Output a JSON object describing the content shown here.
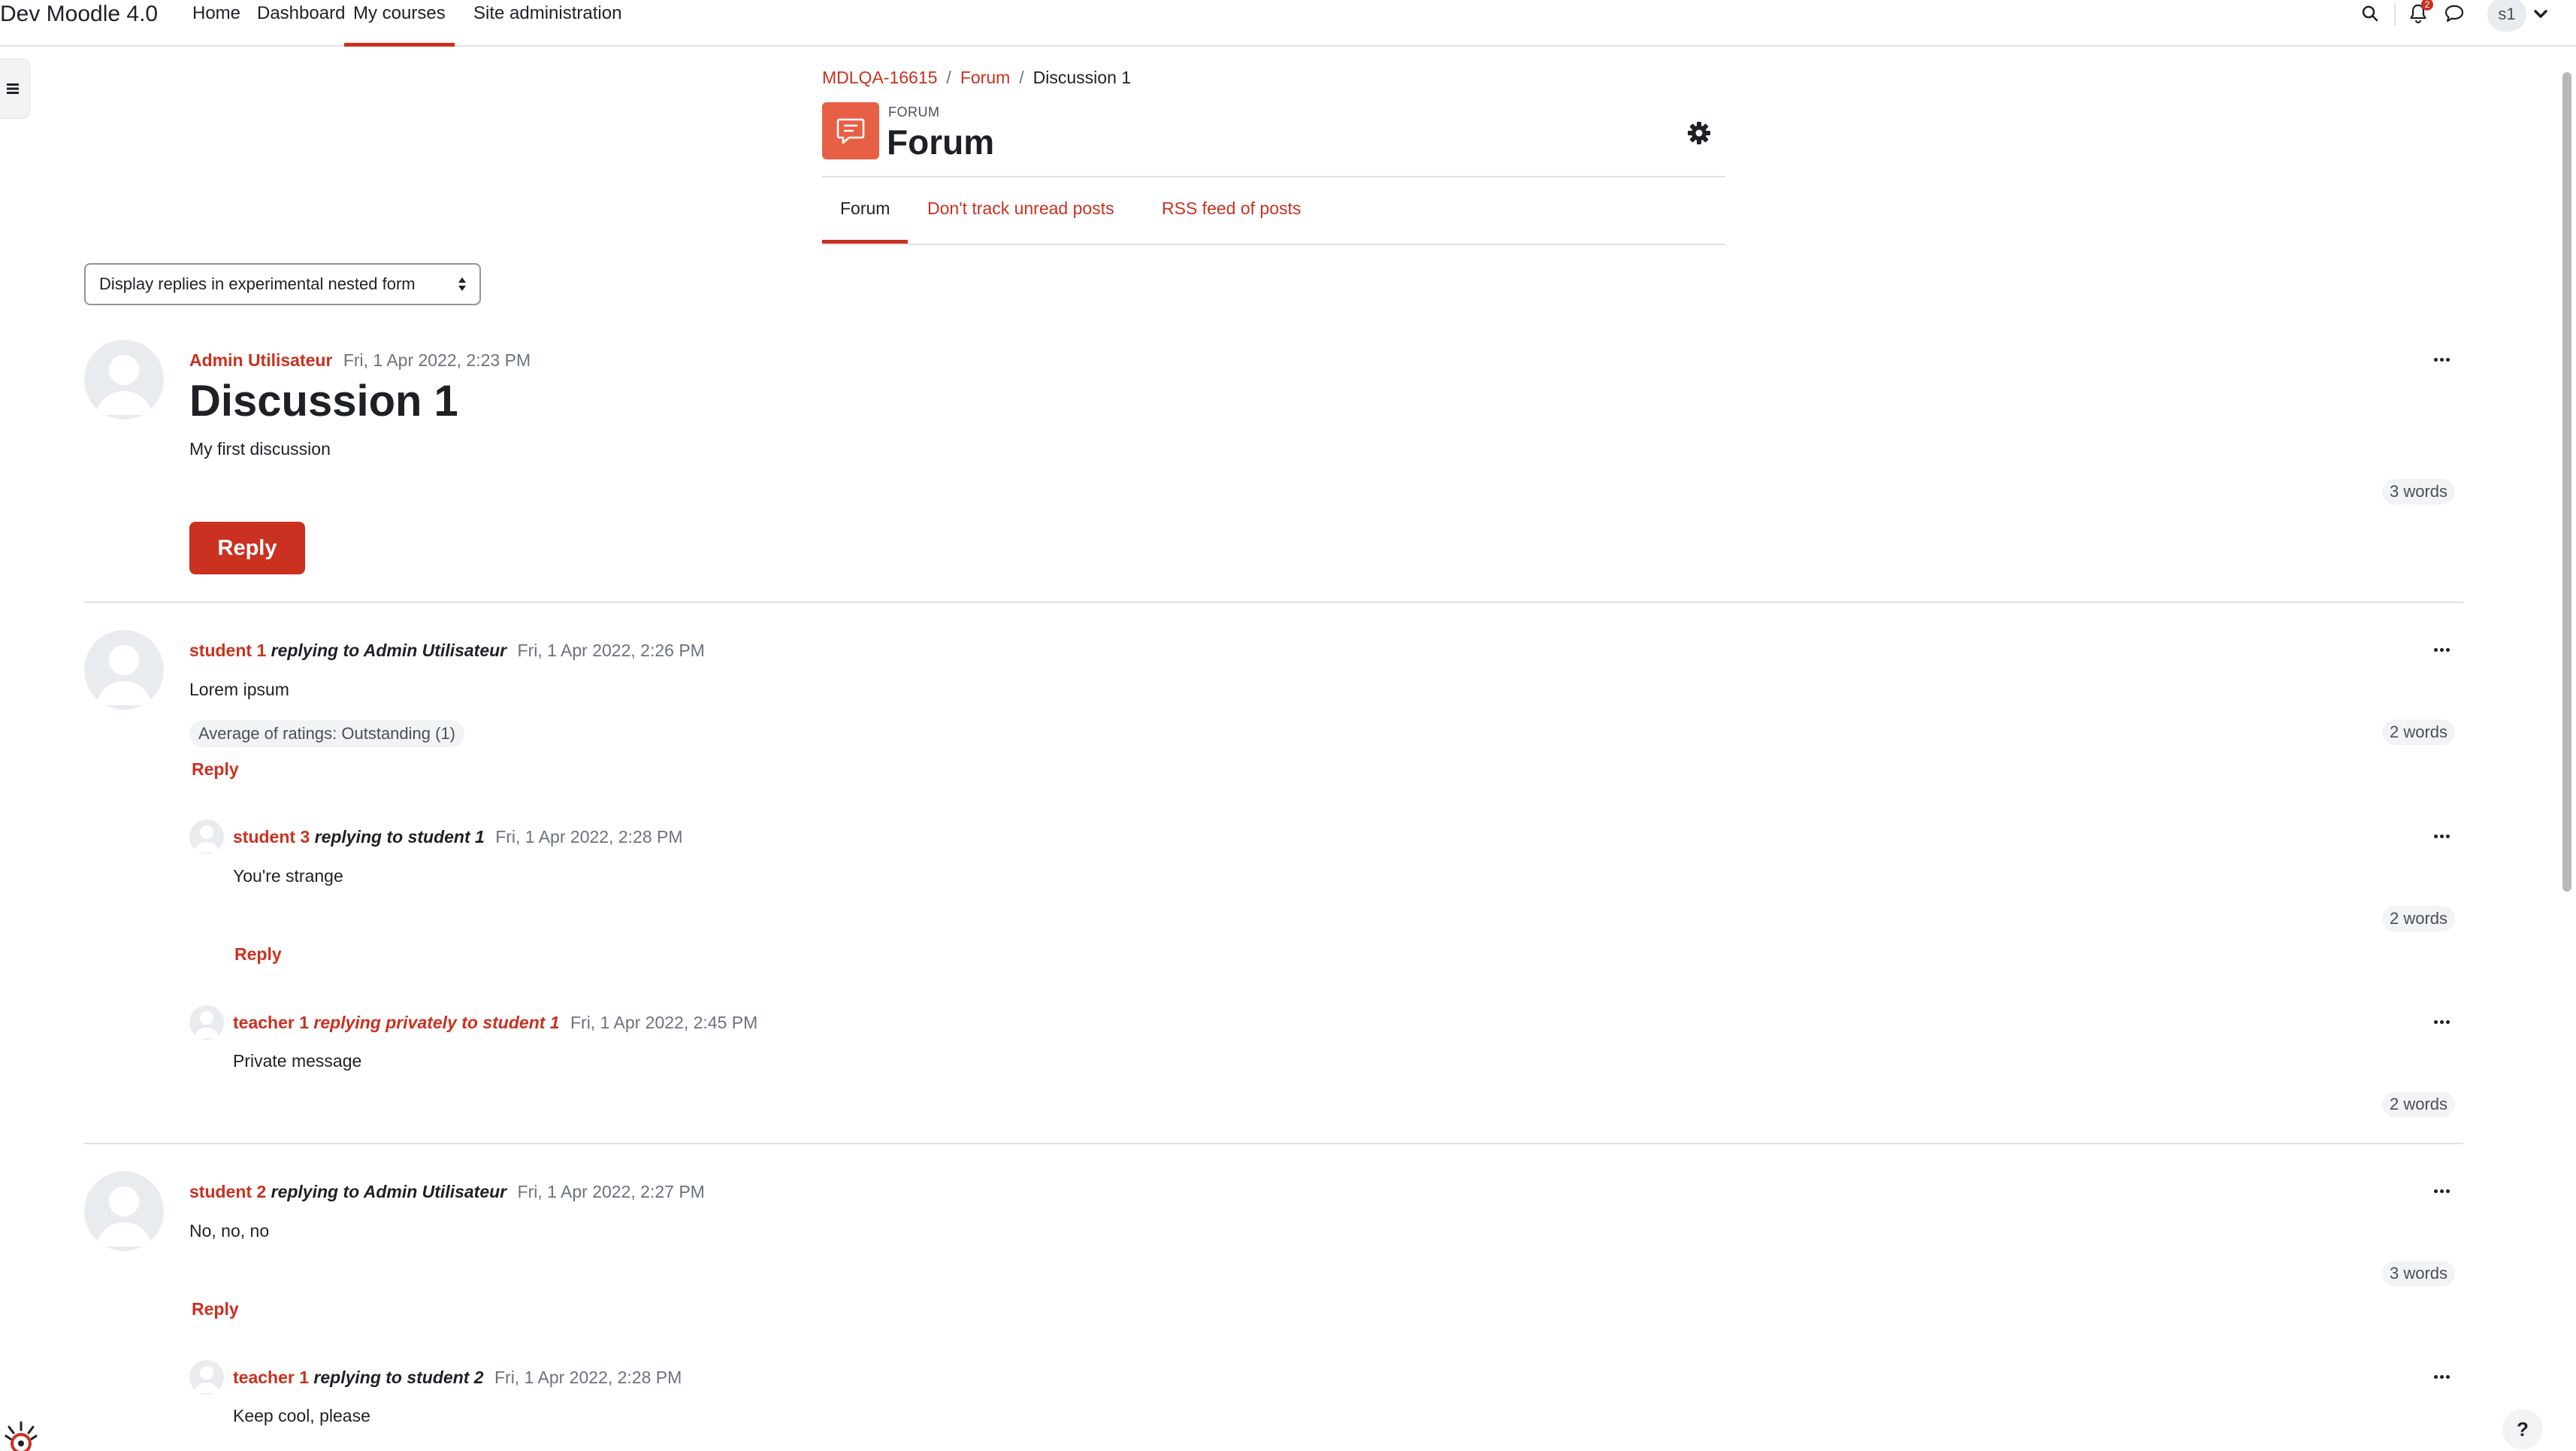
{
  "navbar": {
    "brand": "Dev Moodle 4.0",
    "items": [
      {
        "label": "Home"
      },
      {
        "label": "Dashboard"
      },
      {
        "label": "My courses"
      },
      {
        "label": "Site administration"
      }
    ],
    "notification_count": "2",
    "user_initials": "s1"
  },
  "breadcrumb": {
    "items": [
      "MDLQA-16615",
      "Forum",
      "Discussion 1"
    ],
    "separator": "/"
  },
  "header": {
    "pre_title": "FORUM",
    "title": "Forum"
  },
  "tabs": [
    {
      "label": "Forum"
    },
    {
      "label": "Don't track unread posts"
    },
    {
      "label": "RSS feed of posts"
    }
  ],
  "display_mode": {
    "selected": "Display replies in experimental nested form"
  },
  "discussion": {
    "author": "Admin Utilisateur",
    "date": "Fri, 1 Apr 2022, 2:23 PM",
    "subject": "Discussion 1",
    "message": "My first discussion",
    "word_count": "3 words",
    "reply_label": "Reply"
  },
  "replies": [
    {
      "author": "student 1",
      "replying": "replying to Admin Utilisateur",
      "date": "Fri, 1 Apr 2022, 2:26 PM",
      "message": "Lorem ipsum",
      "rating": "Average of ratings: Outstanding (1)",
      "word_count": "2 words",
      "reply_label": "Reply",
      "children": [
        {
          "author": "student 3",
          "replying": "replying to student 1",
          "date": "Fri, 1 Apr 2022, 2:28 PM",
          "message": "You're strange",
          "word_count": "2 words",
          "reply_label": "Reply"
        },
        {
          "author": "teacher 1",
          "replying": "replying privately to student 1",
          "date": "Fri, 1 Apr 2022, 2:45 PM",
          "message": "Private message",
          "word_count": "2 words"
        }
      ]
    },
    {
      "author": "student 2",
      "replying": "replying to Admin Utilisateur",
      "date": "Fri, 1 Apr 2022, 2:27 PM",
      "message": "No, no, no",
      "word_count": "3 words",
      "reply_label": "Reply",
      "children": [
        {
          "author": "teacher 1",
          "replying": "replying to student 2",
          "date": "Fri, 1 Apr 2022, 2:28 PM",
          "message": "Keep cool, please"
        }
      ]
    }
  ],
  "help_label": "?",
  "colors": {
    "brand": "#ca3120",
    "forum_icon": "#e75f45",
    "text": "#1d2125",
    "muted": "#6a737b",
    "badge_bg": "#f1f3f5"
  }
}
